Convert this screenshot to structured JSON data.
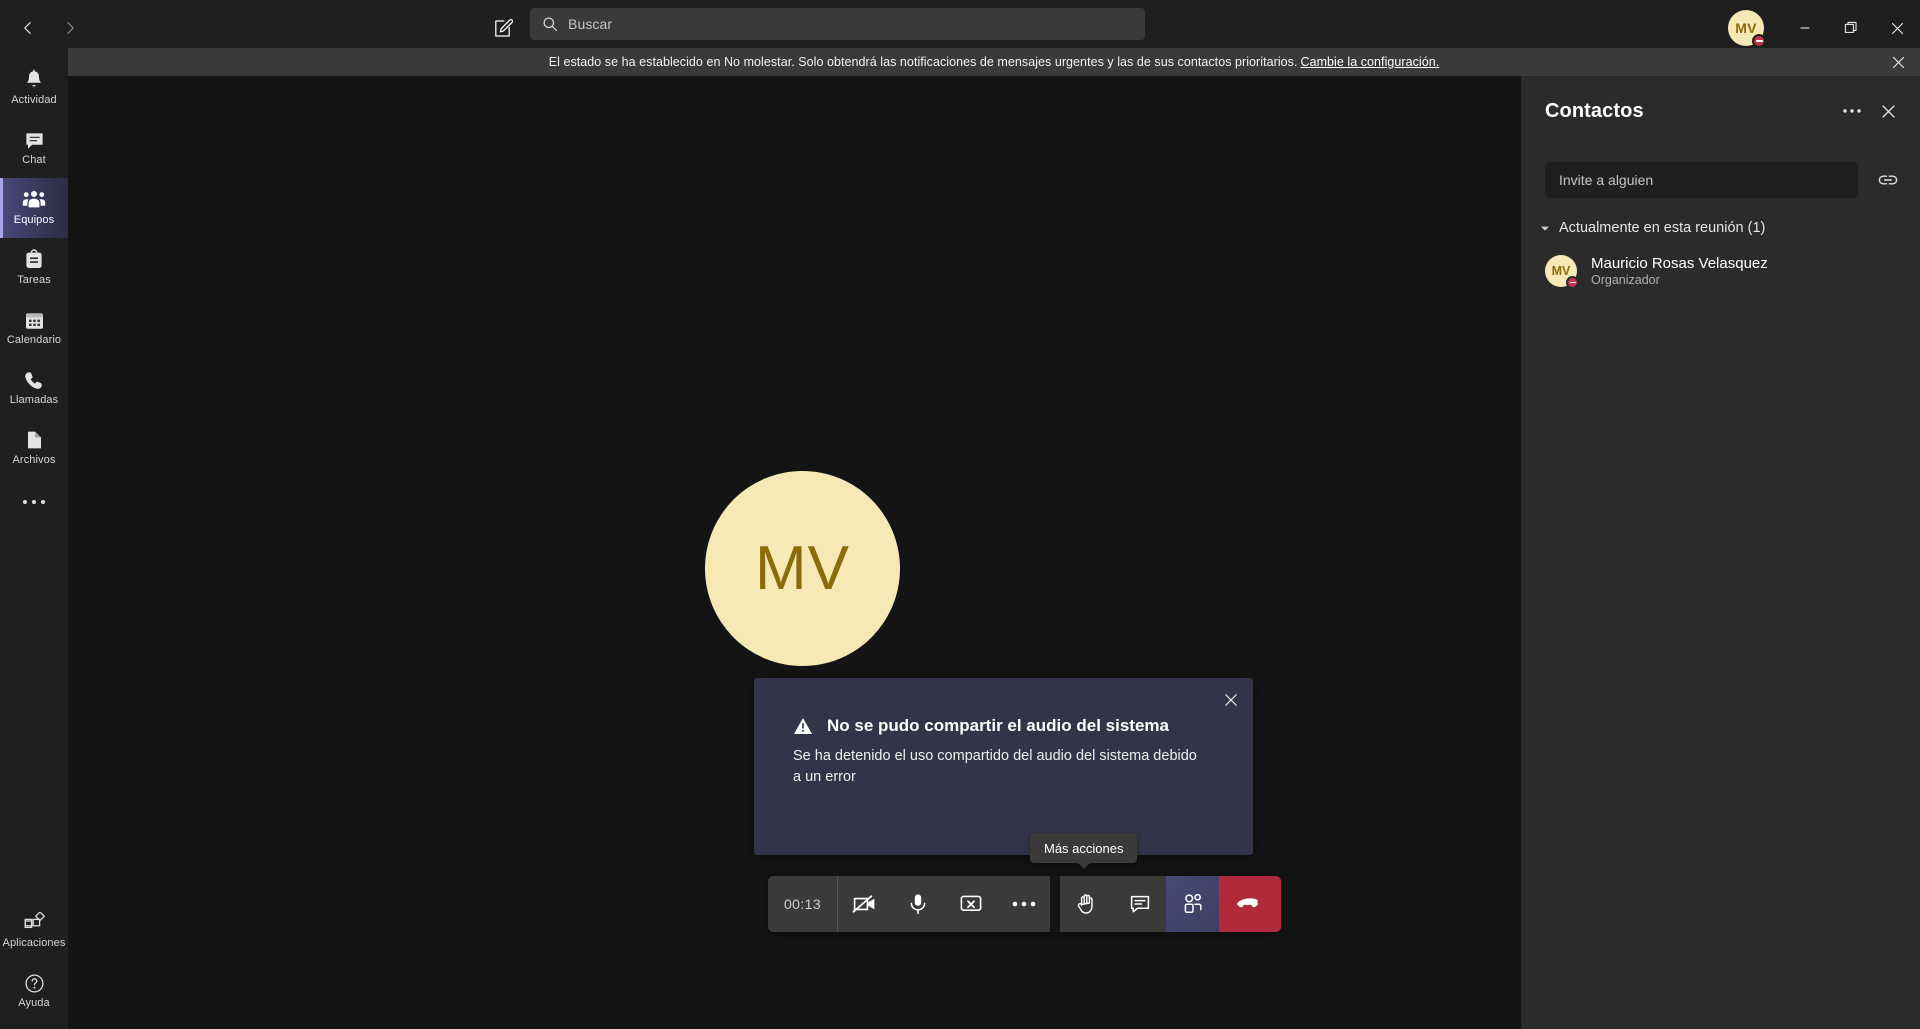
{
  "titlebar": {
    "back_icon": "chevron-left-icon",
    "forward_icon": "chevron-right-icon",
    "compose_icon": "compose-new-chat-icon",
    "search": {
      "placeholder": "Buscar",
      "value": "Buscar",
      "icon": "search-icon"
    },
    "account": {
      "initials": "MV",
      "presence": "No molestar"
    },
    "window": {
      "minimize_label": "Minimizar",
      "maximize_label": "Maximizar",
      "close_label": "Cerrar"
    }
  },
  "banner": {
    "text": "El estado se ha establecido en No molestar. Solo obtendrá las notificaciones de mensajes urgentes y las de sus contactos prioritarios.",
    "link": "Cambie la configuración.",
    "close_icon": "close-icon"
  },
  "rail": {
    "items": [
      {
        "label": "Actividad",
        "icon": "bell-icon",
        "active": false
      },
      {
        "label": "Chat",
        "icon": "chat-bubble-icon",
        "active": false
      },
      {
        "label": "Equipos",
        "icon": "teams-people-icon",
        "active": true
      },
      {
        "label": "Tareas",
        "icon": "tasks-icon",
        "active": false
      },
      {
        "label": "Calendario",
        "icon": "calendar-icon",
        "active": false
      },
      {
        "label": "Llamadas",
        "icon": "phone-icon",
        "active": false
      },
      {
        "label": "Archivos",
        "icon": "file-icon",
        "active": false
      }
    ],
    "more_label": "Más aplicaciones",
    "more_icon": "ellipsis-icon",
    "bottom": [
      {
        "label": "Aplicaciones",
        "icon": "apps-grid-icon"
      },
      {
        "label": "Ayuda",
        "icon": "help-question-icon"
      }
    ]
  },
  "stage": {
    "participant_initials": "MV"
  },
  "toast": {
    "icon": "warning-triangle-icon",
    "title": "No se pudo compartir el audio del sistema",
    "body": "Se ha detenido el uso compartido del audio del sistema debido a un error",
    "close_icon": "close-icon"
  },
  "tooltip": {
    "text": "Más acciones"
  },
  "callbar": {
    "timer": "00:13",
    "buttons": [
      {
        "name": "camera",
        "label": "Cámara desactivada",
        "icon": "camera-off-icon"
      },
      {
        "name": "microphone",
        "label": "Silenciar",
        "icon": "microphone-icon"
      },
      {
        "name": "share",
        "label": "Dejar de compartir",
        "icon": "share-screen-stop-icon"
      },
      {
        "name": "more",
        "label": "Más acciones",
        "icon": "ellipsis-icon"
      },
      {
        "name": "raise-hand",
        "label": "Levantar la mano",
        "icon": "raise-hand-icon"
      },
      {
        "name": "chat",
        "label": "Mostrar conversación",
        "icon": "chat-bubble-icon"
      },
      {
        "name": "people",
        "label": "Mostrar participantes",
        "icon": "people-icon"
      },
      {
        "name": "hangup",
        "label": "Colgar",
        "icon": "hangup-phone-icon"
      }
    ]
  },
  "panel": {
    "title": "Contactos",
    "more_icon": "ellipsis-icon",
    "close_icon": "close-icon",
    "invite": {
      "placeholder": "Invite a alguien",
      "value": "",
      "link_icon": "copy-link-icon"
    },
    "section": {
      "caret_icon": "caret-down-icon",
      "title": "Actualmente en esta reunión (1)"
    },
    "roster": [
      {
        "initials": "MV",
        "name": "Mauricio Rosas Velasquez",
        "role": "Organizador",
        "presence": "No molestar"
      }
    ]
  },
  "colors": {
    "app_bg": "#1f1f1f",
    "stage_bg": "#141414",
    "panel_bg": "#2b2b2b",
    "banner_bg": "#3b3a39",
    "accent_purple": "#6264a7",
    "toast_bg": "#33344a",
    "hangup_red": "#b02a3c",
    "dnd_red": "#c4314b",
    "avatar_bg": "#f7e9b6",
    "avatar_fg": "#8a6d0b"
  }
}
